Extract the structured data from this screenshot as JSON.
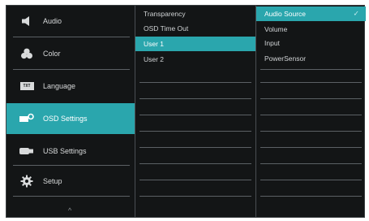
{
  "main_menu": {
    "items": [
      {
        "label": "Audio",
        "icon": "speaker-icon",
        "active": false
      },
      {
        "label": "Color",
        "icon": "color-icon",
        "active": false
      },
      {
        "label": "Language",
        "icon": "language-icon",
        "active": false
      },
      {
        "label": "OSD Settings",
        "icon": "osd-settings-icon",
        "active": true
      },
      {
        "label": "USB Settings",
        "icon": "usb-icon",
        "active": false
      },
      {
        "label": "Setup",
        "icon": "gear-icon",
        "active": false
      }
    ],
    "language_icon_text": "TXT",
    "scroll_up_glyph": "^"
  },
  "submenu": {
    "items": [
      "Transparency",
      "OSD Time Out",
      "User 1",
      "User 2"
    ],
    "selected_index": 2
  },
  "options": {
    "items": [
      "Audio Source",
      "Volume",
      "Input",
      "PowerSensor"
    ],
    "selected_index": 0,
    "check_glyph": "✓"
  },
  "colors": {
    "accent": "#2aa6ad",
    "background": "#131516",
    "text": "#d8dadb"
  }
}
